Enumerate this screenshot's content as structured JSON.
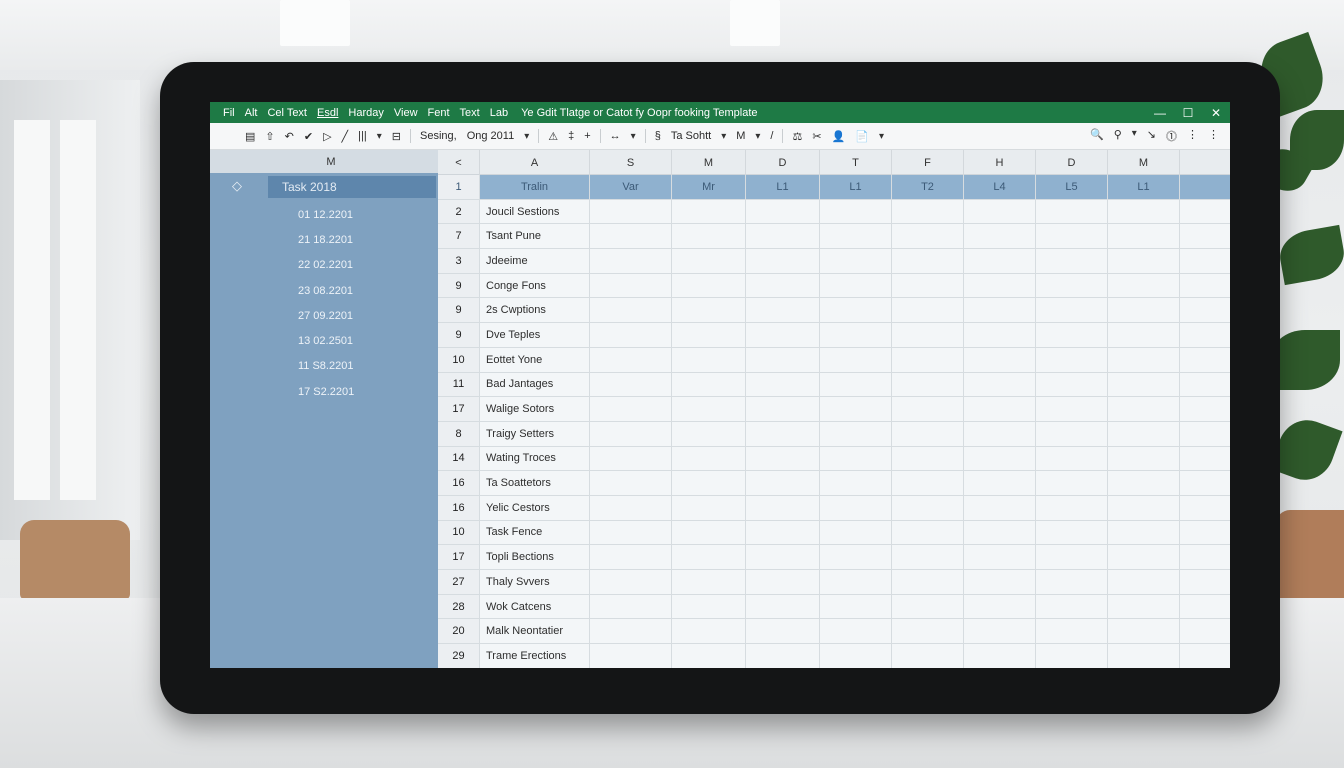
{
  "titlebar": {
    "menu": [
      "Fil",
      "Alt",
      "Cel Text",
      "Esdl",
      "Harday",
      "View",
      "Fent",
      "Text",
      "Lab"
    ],
    "doc_title": "Ye Gdit Tlatge or Catot fy Oopr fooking Template",
    "controls": {
      "minimize": "—",
      "maximize": "☐",
      "close": "✕"
    }
  },
  "toolbar": {
    "left": [
      "▤",
      "⇧",
      "↶",
      "✔",
      "▷",
      "╱",
      "|||",
      "▾",
      "⊟",
      "Sesing,",
      "Ong 2011",
      "▾",
      "⚠",
      "‡",
      "+",
      "↔",
      "▾",
      "§",
      "Ta Sohtt",
      "▾",
      "M",
      "▾",
      "/",
      "⚖",
      "✂",
      "👤",
      "📄",
      "▾"
    ],
    "right": [
      "🔍",
      "⚲",
      "▾",
      "↘",
      "⓵",
      "⋮",
      "⋮"
    ]
  },
  "sidebar": {
    "header": "M",
    "toggle_icon": "◇",
    "task_label": "Task 2018",
    "items": [
      "01  12.2201",
      "21  18.2201",
      "22  02.2201",
      "23  08.2201",
      "27  09.2201",
      "13  02.2501",
      "11  S8.2201",
      "17  S2.2201"
    ]
  },
  "grid": {
    "corner": "<",
    "columns": [
      "A",
      "S",
      "M",
      "D",
      "T",
      "F",
      "H",
      "D",
      "M"
    ],
    "header_row": {
      "num": "1",
      "cells": [
        "Tralin",
        "Var",
        "Mr",
        "L1",
        "L1",
        "T2",
        "L4",
        "L5",
        "L1"
      ]
    },
    "rows": [
      {
        "num": "2",
        "name": "Joucil Sestions"
      },
      {
        "num": "7",
        "name": "Tsant Pune"
      },
      {
        "num": "3",
        "name": "Jdeeime"
      },
      {
        "num": "9",
        "name": "Conge Fons"
      },
      {
        "num": "9",
        "name": "2s Cwptions"
      },
      {
        "num": "9",
        "name": "Dve Teples"
      },
      {
        "num": "10",
        "name": "Eottet Yone"
      },
      {
        "num": "11",
        "name": "Bad Jantages"
      },
      {
        "num": "17",
        "name": "Walige Sotors"
      },
      {
        "num": "8",
        "name": "Traigy Setters"
      },
      {
        "num": "14",
        "name": "Wating Troces"
      },
      {
        "num": "16",
        "name": "Ta Soattetors"
      },
      {
        "num": "16",
        "name": "Yelic Cestors"
      },
      {
        "num": "10",
        "name": "Task Fence"
      },
      {
        "num": "17",
        "name": "Topli Bections"
      },
      {
        "num": "27",
        "name": "Thaly Svvers"
      },
      {
        "num": "28",
        "name": "Wok Catcens"
      },
      {
        "num": "20",
        "name": "Malk Neontatier"
      },
      {
        "num": "29",
        "name": "Trame Erections"
      }
    ]
  },
  "colors": {
    "titlebar": "#1e7a45",
    "sidebar": "#7fa1c0",
    "header_row": "#8fb1cf"
  }
}
